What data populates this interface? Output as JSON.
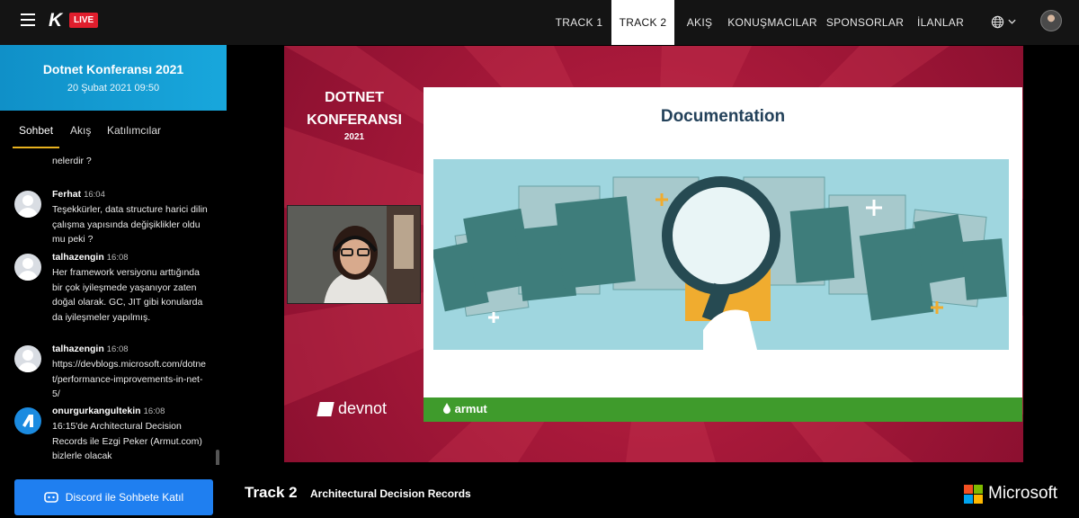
{
  "header": {
    "logo_letter": "K",
    "live_label": "LIVE",
    "nav": [
      {
        "label": "TRACK 1"
      },
      {
        "label": "TRACK 2"
      },
      {
        "label": "AKIŞ"
      },
      {
        "label": "KONUŞMACILAR"
      },
      {
        "label": "SPONSORLAR"
      },
      {
        "label": "İLANLAR"
      }
    ],
    "active_nav": "TRACK 2",
    "language_icon": "globe-icon"
  },
  "event": {
    "title": "Dotnet Konferansı 2021",
    "date": "20 Şubat 2021 09:50"
  },
  "tabs": [
    {
      "label": "Sohbet"
    },
    {
      "label": "Akış"
    },
    {
      "label": "Katılımcılar"
    }
  ],
  "chat": {
    "partial_top": "nelerdir ?",
    "messages": [
      {
        "user": "Ferhat",
        "time": "16:04",
        "text": "Teşekkürler, data structure harici dilin çalışma yapısında değişiklikler oldu mu peki ?"
      },
      {
        "user": "talhazengin",
        "time": "16:08",
        "text": "Her framework versiyonu arttığında bir çok iyileşmede yaşanıyor zaten doğal olarak. GC, JIT gibi konularda da iyileşmeler yapılmış."
      },
      {
        "user": "talhazengin",
        "time": "16:08",
        "text": "https://devblogs.microsoft.com/dotnet/performance-improvements-in-net-5/"
      },
      {
        "user": "onurgurkangultekin",
        "time": "16:08",
        "text": "16:15'de Architectural Decision Records ile Ezgi Peker (Armut.com) bizlerle olacak"
      }
    ]
  },
  "discord_button": "Discord ile Sohbete Katıl",
  "slide": {
    "left_title_line1": "DOTNET",
    "left_title_line2": "KONFERANSI",
    "left_year": "2021",
    "heading": "Documentation",
    "devnot_label": "devnot",
    "armut_label": "armut"
  },
  "footer": {
    "track": "Track 2",
    "session": "Architectural Decision Records",
    "sponsor": "Microsoft"
  },
  "colors": {
    "live_red": "#e01e2d",
    "banner_blue": "#18a7dc",
    "tab_underline": "#e8b21f",
    "discord_blue": "#1f7ff0",
    "slide_red": "#a8193a",
    "armut_green": "#3f9b2c"
  }
}
